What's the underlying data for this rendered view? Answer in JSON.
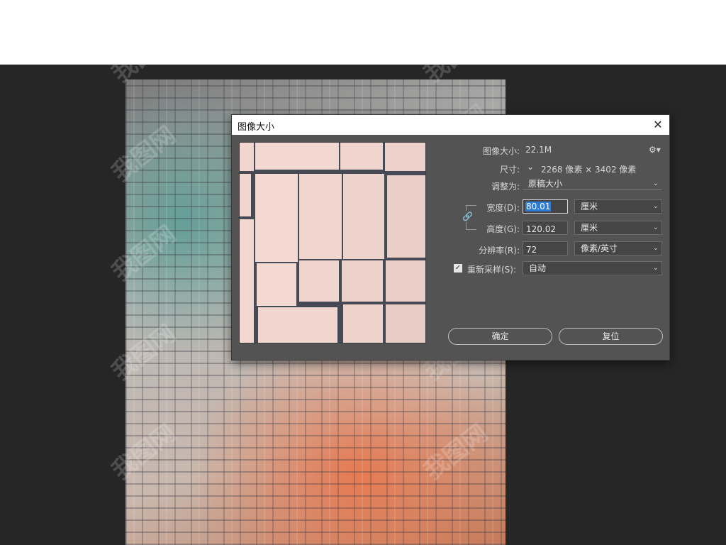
{
  "dialog": {
    "title": "图像大小",
    "close_glyph": "✕",
    "image_size_label": "图像大小:",
    "image_size_value": "22.1M",
    "dimensions_label": "尺寸:",
    "dimensions_value": "2268 像素 × 3402 像素",
    "fit_to_label": "调整为:",
    "fit_to_value": "原稿大小",
    "width_label": "宽度(D):",
    "width_value": "80.01",
    "width_unit": "厘米",
    "height_label": "高度(G):",
    "height_value": "120.02",
    "height_unit": "厘米",
    "resolution_label": "分辨率(R):",
    "resolution_value": "72",
    "resolution_unit": "像素/英寸",
    "resample_label": "重新采样(S):",
    "resample_checked": true,
    "resample_value": "自动",
    "ok_label": "确定",
    "reset_label": "复位",
    "link_icon": "chain-link-icon",
    "gear_icon": "gear-icon"
  },
  "colors": {
    "canvas_bg": "#262626",
    "dialog_bg": "#535353",
    "selection_blue": "#2e7bd6",
    "preview_tile": "#f1d6cf",
    "preview_grout": "#474955"
  },
  "watermark": {
    "text": "我图网"
  }
}
